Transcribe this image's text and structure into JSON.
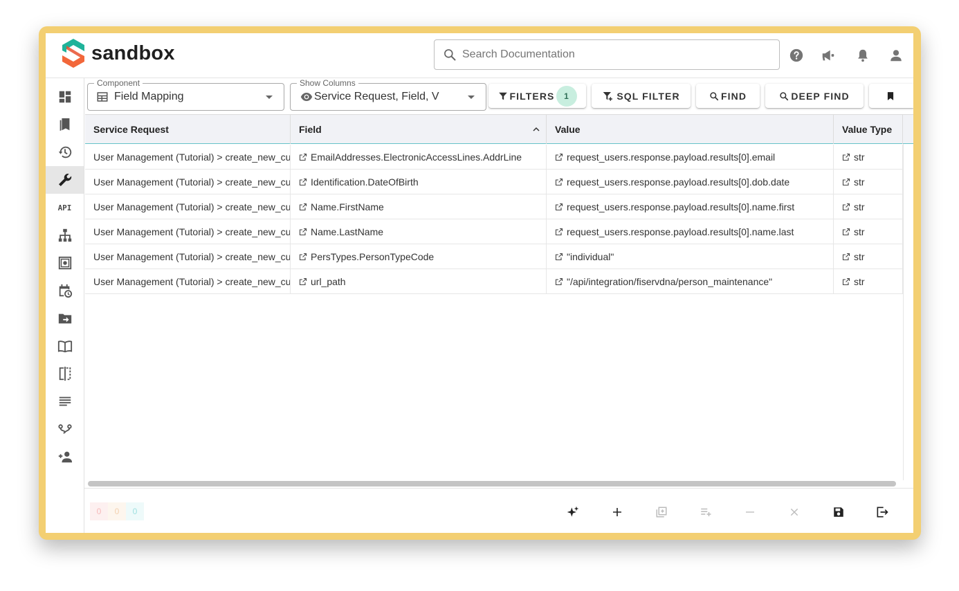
{
  "app": {
    "logo_text": "sandbox"
  },
  "search": {
    "placeholder": "Search Documentation"
  },
  "header_icons": [
    "help-icon",
    "announcement-icon",
    "notifications-icon",
    "account-icon"
  ],
  "sidebar": {
    "items": [
      {
        "name": "dashboard-icon"
      },
      {
        "name": "bookmarks-icon"
      },
      {
        "name": "history-icon"
      },
      {
        "name": "wrench-icon",
        "active": true
      },
      {
        "name": "api-icon",
        "label": "API"
      },
      {
        "name": "sitemap-icon"
      },
      {
        "name": "safe-icon"
      },
      {
        "name": "calendar-clock-icon"
      },
      {
        "name": "folder-move-icon"
      },
      {
        "name": "book-open-icon"
      },
      {
        "name": "compare-icon"
      },
      {
        "name": "text-lines-icon"
      },
      {
        "name": "tour-icon"
      },
      {
        "name": "add-user-icon"
      }
    ]
  },
  "toolbar": {
    "component": {
      "legend": "Component",
      "value": "Field Mapping"
    },
    "show_columns": {
      "legend": "Show Columns",
      "value": "Service Request, Field, V"
    },
    "filters_label": "FILTERS",
    "filters_count": "1",
    "sql_filter_label": "SQL FILTER",
    "find_label": "FIND",
    "deep_find_label": "DEEP FIND"
  },
  "grid": {
    "columns": [
      "Service Request",
      "Field",
      "Value",
      "Value Type"
    ],
    "sorted_column": "Field",
    "rows": [
      {
        "service_request": "User Management (Tutorial) > create_new_cu",
        "field": "EmailAddresses.ElectronicAccessLines.AddrLine",
        "value": "request_users.response.payload.results[0].email",
        "value_type": "str"
      },
      {
        "service_request": "User Management (Tutorial) > create_new_cu",
        "field": "Identification.DateOfBirth",
        "value": "request_users.response.payload.results[0].dob.date",
        "value_type": "str"
      },
      {
        "service_request": "User Management (Tutorial) > create_new_cu",
        "field": "Name.FirstName",
        "value": "request_users.response.payload.results[0].name.first",
        "value_type": "str"
      },
      {
        "service_request": "User Management (Tutorial) > create_new_cu",
        "field": "Name.LastName",
        "value": "request_users.response.payload.results[0].name.last",
        "value_type": "str"
      },
      {
        "service_request": "User Management (Tutorial) > create_new_cu",
        "field": "PersTypes.PersonTypeCode",
        "value": "\"individual\"",
        "value_type": "str"
      },
      {
        "service_request": "User Management (Tutorial) > create_new_cu",
        "field": "url_path",
        "value": "\"/api/integration/fiservdna/person_maintenance\"",
        "value_type": "str"
      }
    ]
  },
  "footer": {
    "counts": [
      "0",
      "0",
      "0"
    ],
    "count_colors": [
      "#f6b9b9",
      "#f3d1b0",
      "#9fe0e0"
    ]
  },
  "colors": {
    "accent_teal": "#66c2c9",
    "badge_bg": "#c8eedf",
    "logo_teal": "#1fb39a",
    "logo_orange": "#f2673a"
  }
}
